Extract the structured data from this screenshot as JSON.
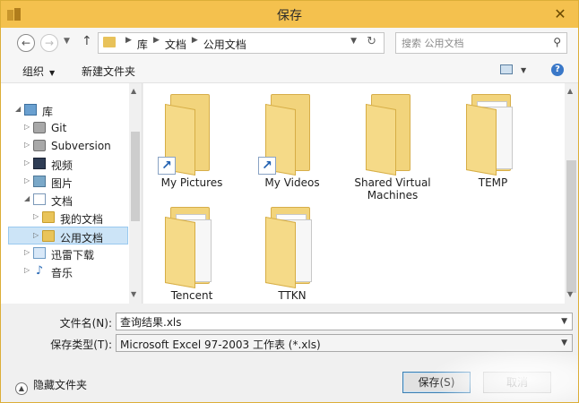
{
  "window": {
    "title": "保存",
    "close_glyph": "✕",
    "title_color": "#f4c14e"
  },
  "address_bar": {
    "crumbs": [
      "库",
      "文档",
      "公用文档"
    ],
    "separator": "▶",
    "search_placeholder": "搜索 公用文档"
  },
  "toolbar": {
    "organize_label": "组织",
    "new_folder_label": "新建文件夹",
    "help_glyph": "?"
  },
  "nav_tree": [
    {
      "label": "库",
      "icon": "library-icon",
      "arrow": "◢",
      "level": 0
    },
    {
      "label": "Git",
      "icon": "git-icon",
      "arrow": "▷",
      "level": 1
    },
    {
      "label": "Subversion",
      "icon": "subversion-icon",
      "arrow": "▷",
      "level": 1
    },
    {
      "label": "视频",
      "icon": "video-icon",
      "arrow": "▷",
      "level": 1
    },
    {
      "label": "图片",
      "icon": "pictures-icon",
      "arrow": "▷",
      "level": 1
    },
    {
      "label": "文档",
      "icon": "documents-icon",
      "arrow": "◢",
      "level": 1
    },
    {
      "label": "我的文档",
      "icon": "folder-icon",
      "arrow": "▷",
      "level": 2
    },
    {
      "label": "公用文档",
      "icon": "folder-icon",
      "arrow": "▷",
      "level": 2,
      "selected": true
    },
    {
      "label": "迅雷下载",
      "icon": "xunlei-icon",
      "arrow": "▷",
      "level": 1
    },
    {
      "label": "音乐",
      "icon": "music-icon",
      "arrow": "▷",
      "level": 1
    }
  ],
  "files": [
    {
      "label": "My Pictures",
      "shortcut": true
    },
    {
      "label": "My Videos",
      "shortcut": true
    },
    {
      "label": "Shared Virtual Machines",
      "shortcut": false
    },
    {
      "label": "TEMP",
      "shortcut": false
    },
    {
      "label": "Tencent",
      "shortcut": false
    },
    {
      "label": "TTKN",
      "shortcut": false
    }
  ],
  "form": {
    "filename_label": "文件名(N):",
    "filename_value": "查询结果.xls",
    "filetype_label": "保存类型(T):",
    "filetype_value": "Microsoft Excel 97-2003 工作表 (*.xls)"
  },
  "footer": {
    "hide_folders_label": "隐藏文件夹",
    "save_label": "保存(S)",
    "cancel_label": "取消"
  }
}
